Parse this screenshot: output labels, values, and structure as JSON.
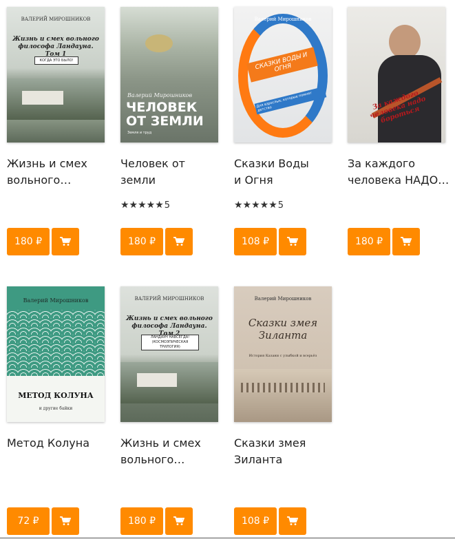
{
  "currency": "₽",
  "colors": {
    "accent": "#ff8a00",
    "text": "#222222"
  },
  "books": [
    {
      "title": "Жизнь и смех\nвольного…",
      "price": "180 ₽",
      "rating": null,
      "cover": {
        "author": "ВАЛЕРИЙ МИРОШНИКОВ",
        "title": "Жизнь и смех вольного философа Ландауна. Том 1",
        "subtitle": "КОГДА ЭТО БЫЛО!"
      }
    },
    {
      "title": "Человек от земли",
      "price": "180 ₽",
      "rating": {
        "stars": "★★★★★",
        "value": "5"
      },
      "cover": {
        "author": "Валерий Мирошников",
        "title": "ЧЕЛОВЕК ОТ ЗЕМЛИ",
        "subtitle": "Земля и труд"
      }
    },
    {
      "title": "Сказки Воды\nи Огня",
      "price": "108 ₽",
      "rating": {
        "stars": "★★★★★",
        "value": "5"
      },
      "cover": {
        "author": "Валерий Мирошников",
        "title": "СКАЗКИ ВОДЫ И ОГНЯ",
        "subtitle": "Для взрослых, которые помнят детство"
      }
    },
    {
      "title": "За каждого\nчеловека НАДО…",
      "price": "180 ₽",
      "rating": null,
      "cover": {
        "author": "",
        "title": "За каждого человека надо бороться",
        "subtitle": ""
      }
    },
    {
      "title": "Метод Колуна",
      "price": "72 ₽",
      "rating": null,
      "cover": {
        "author": "Валерий Мирошников",
        "title": "МЕТОД КОЛУНА",
        "subtitle": "и другие байки"
      }
    },
    {
      "title": "Жизнь и смех\nвольного…",
      "price": "180 ₽",
      "rating": null,
      "cover": {
        "author": "ВАЛЕРИЙ МИРОШНИКОВ",
        "title": "Жизнь и смех вольного философа Ландауна. Том 2",
        "subtitle": "ЛАНДАУН НАВСЕГДА! (КОСМОЭПИЧЕСКАЯ ТРИЛОГИЯ)"
      }
    },
    {
      "title": "Сказки змея\nЗиланта",
      "price": "108 ₽",
      "rating": null,
      "cover": {
        "author": "Валерий Мирошников",
        "title": "Сказки змея Зиланта",
        "subtitle": "История Казани с улыбкой и всерьёз"
      }
    }
  ]
}
